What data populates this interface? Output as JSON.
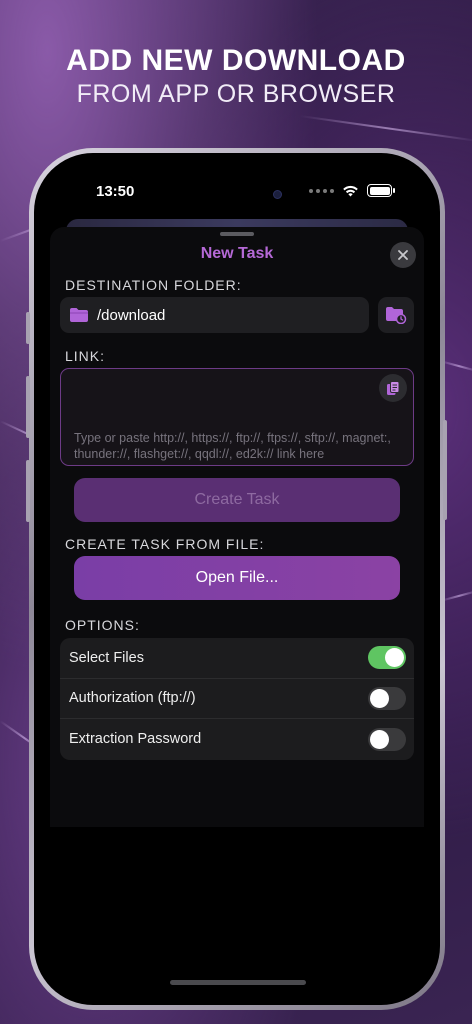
{
  "headline": {
    "line1": "ADD NEW DOWNLOAD",
    "line2": "FROM APP OR BROWSER"
  },
  "status_bar": {
    "time": "13:50"
  },
  "sheet": {
    "title": "New Task",
    "destination_label": "DESTINATION FOLDER:",
    "destination_value": "/download",
    "link_label": "LINK:",
    "link_placeholder": "Type or paste http://, https://, ftp://, ftps://, sftp://, magnet:, thunder://, flashget://, qqdl://, ed2k:// link here",
    "create_task_label": "Create Task",
    "from_file_label": "CREATE TASK FROM FILE:",
    "open_file_label": "Open File...",
    "options_label": "OPTIONS:",
    "options": [
      {
        "label": "Select Files",
        "enabled": true
      },
      {
        "label": "Authorization (ftp://)",
        "enabled": false
      },
      {
        "label": "Extraction Password",
        "enabled": false
      }
    ]
  },
  "colors": {
    "accent": "#b569d6",
    "button_primary": "#8b42a4",
    "button_disabled": "#5a2f73",
    "toggle_on": "#5fc562"
  },
  "icons": [
    "folder-icon",
    "folder-history-icon",
    "close-icon",
    "paste-icon",
    "wifi-icon",
    "battery-icon"
  ]
}
